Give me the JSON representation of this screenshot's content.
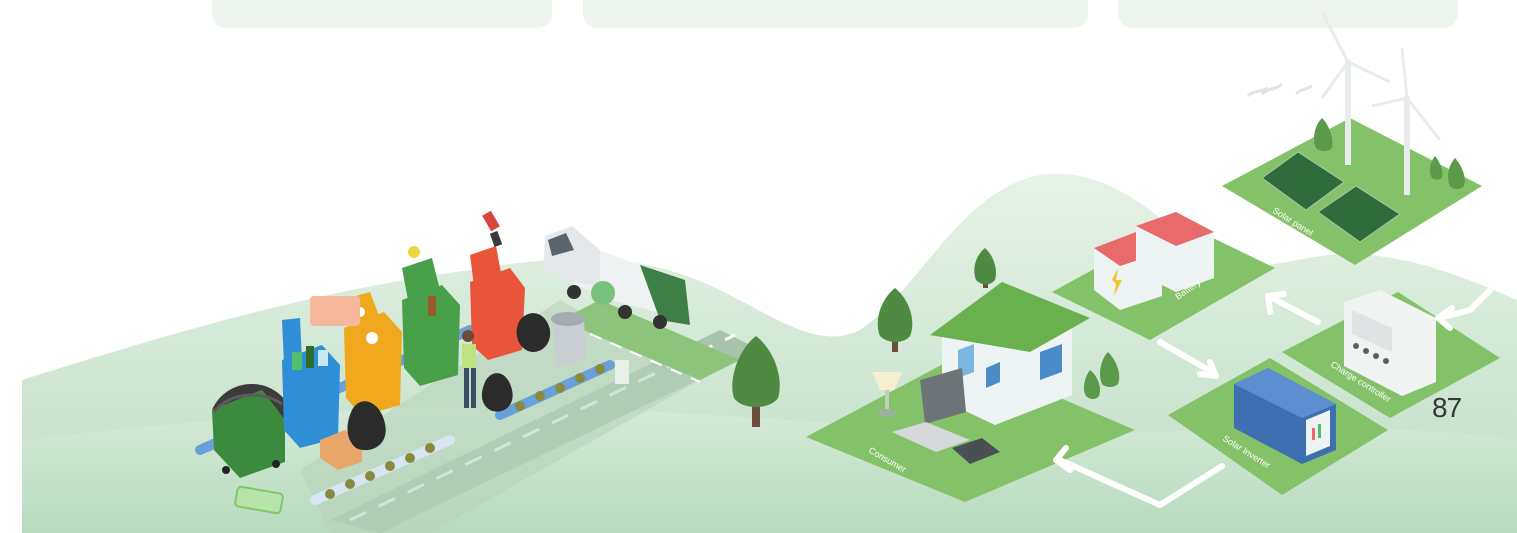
{
  "page_number": "87",
  "labels": {
    "consumer": "Consumer",
    "battery": "Battery",
    "solar_panel": "Solar panel",
    "charge_controller": "Charge controller",
    "solar_inverter": "Solar Inverter"
  },
  "colors": {
    "landscape_green": "#cfe7d2",
    "tile_green": "#84c26a",
    "tree_green": "#5b8f4a",
    "road_grey": "#a9c4ad",
    "arrow_white": "#ffffff",
    "text_dark": "#33373d"
  }
}
